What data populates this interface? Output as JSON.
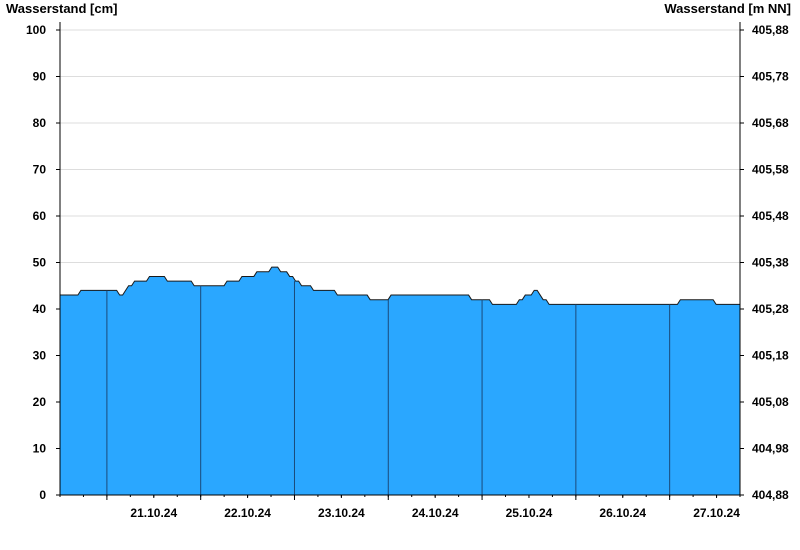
{
  "chart_data": {
    "type": "area",
    "xlabel": "",
    "ylabel": "Wasserstand [cm]",
    "ylabel_right": "Wasserstand [m NN]",
    "ylim": [
      0,
      100
    ],
    "yticks": [
      "0",
      "10",
      "20",
      "30",
      "40",
      "50",
      "60",
      "70",
      "80",
      "90",
      "100"
    ],
    "ylim_right": [
      404.88,
      405.88
    ],
    "yticks_right": [
      "404,88",
      "404,98",
      "405,08",
      "405,18",
      "405,28",
      "405,38",
      "405,48",
      "405,58",
      "405,68",
      "405,78",
      "405,88"
    ],
    "x_start": "20.10.24 12:00",
    "x_end": "27.10.24 18:00",
    "day_labels": [
      "21.10.24",
      "22.10.24",
      "23.10.24",
      "24.10.24",
      "25.10.24",
      "26.10.24",
      "27.10.24"
    ],
    "grid": true,
    "fill_color": "#2aa7ff",
    "series": [
      {
        "values": [
          43,
          43,
          43,
          43,
          43,
          43,
          43,
          44,
          44,
          44,
          44,
          44,
          44,
          44,
          44,
          44,
          44,
          44,
          44,
          44,
          43,
          43,
          44,
          45,
          45,
          46,
          46,
          46,
          46,
          46,
          47,
          47,
          47,
          47,
          47,
          47,
          46,
          46,
          46,
          46,
          46,
          46,
          46,
          46,
          46,
          45,
          45,
          45,
          45,
          45,
          45,
          45,
          45,
          45,
          45,
          45,
          46,
          46,
          46,
          46,
          46,
          47,
          47,
          47,
          47,
          47,
          48,
          48,
          48,
          48,
          48,
          49,
          49,
          49,
          48,
          48,
          48,
          47,
          47,
          46,
          46,
          45,
          45,
          45,
          45,
          44,
          44,
          44,
          44,
          44,
          44,
          44,
          44,
          43,
          43,
          43,
          43,
          43,
          43,
          43,
          43,
          43,
          43,
          43,
          42,
          42,
          42,
          42,
          42,
          42,
          42,
          43,
          43,
          43,
          43,
          43,
          43,
          43,
          43,
          43,
          43,
          43,
          43,
          43,
          43,
          43,
          43,
          43,
          43,
          43,
          43,
          43,
          43,
          43,
          43,
          43,
          43,
          43,
          42,
          42,
          42,
          42,
          42,
          42,
          42,
          41,
          41,
          41,
          41,
          41,
          41,
          41,
          41,
          41,
          42,
          42,
          43,
          43,
          43,
          44,
          44,
          43,
          42,
          42,
          41,
          41,
          41,
          41,
          41,
          41,
          41,
          41,
          41,
          41,
          41,
          41,
          41,
          41,
          41,
          41,
          41,
          41,
          41,
          41,
          41,
          41,
          41,
          41,
          41,
          41,
          41,
          41,
          41,
          41,
          41,
          41,
          41,
          41,
          41,
          41,
          41,
          41,
          41,
          41,
          41,
          41,
          41,
          41,
          42,
          42,
          42,
          42,
          42,
          42,
          42,
          42,
          42,
          42,
          42,
          42,
          41,
          41,
          41,
          41,
          41,
          41,
          41,
          41,
          41
        ]
      }
    ]
  }
}
